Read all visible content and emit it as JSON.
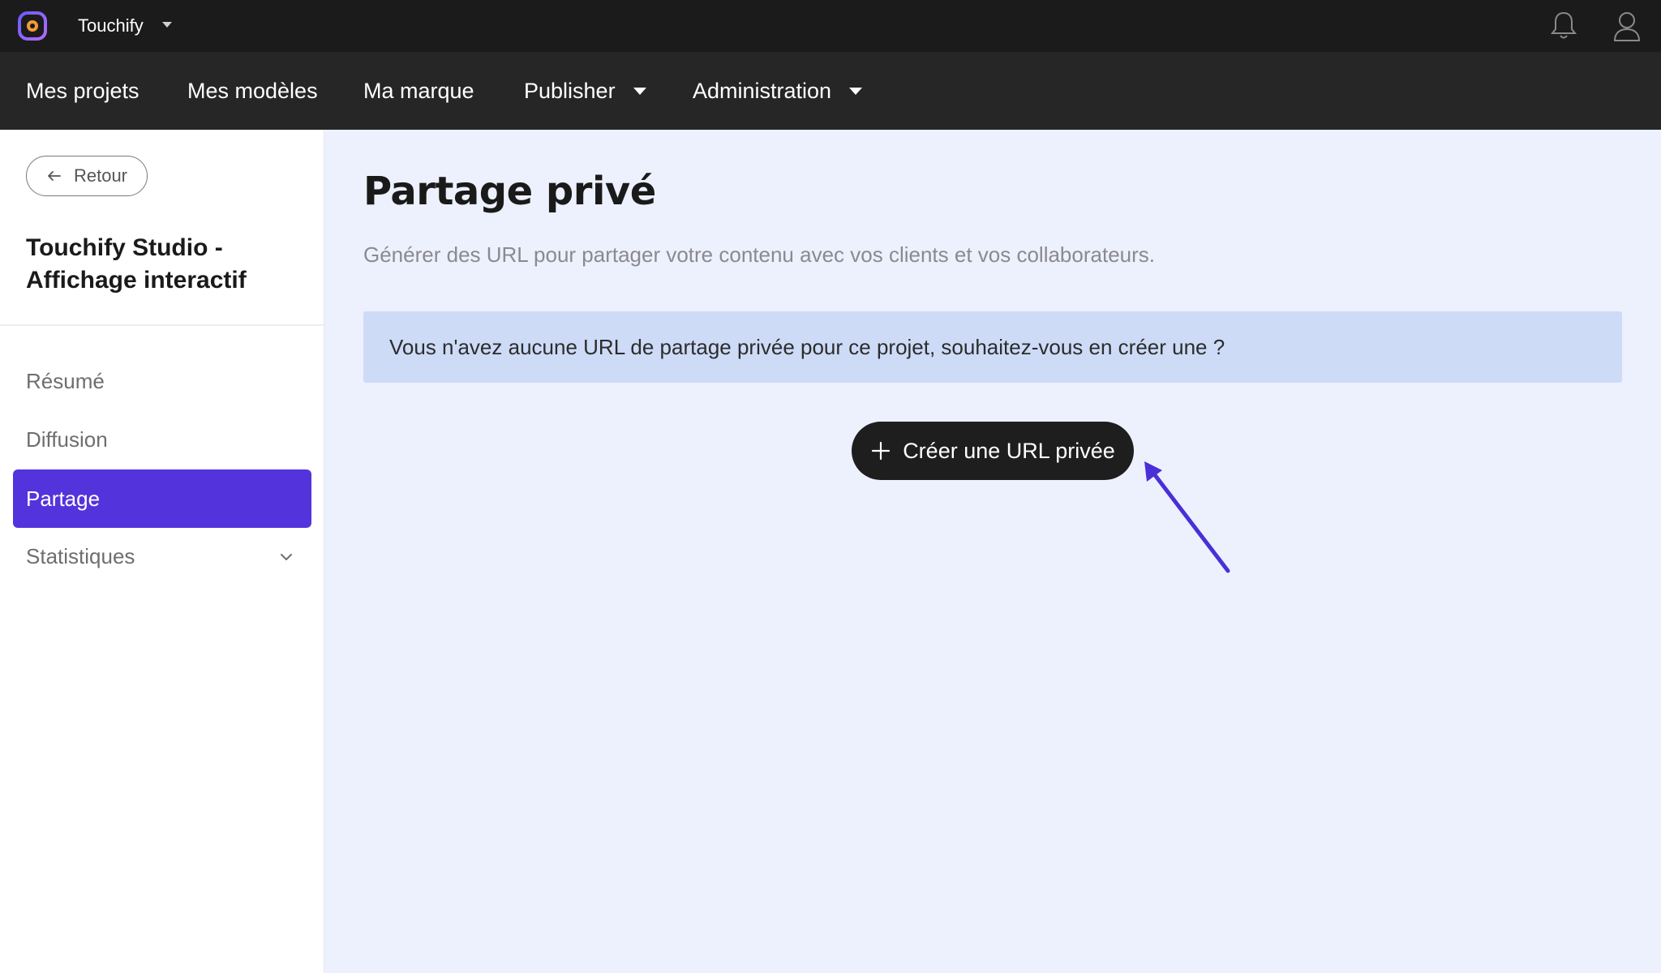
{
  "topbar": {
    "app_name": "Touchify",
    "logo_icon": "touchify-logo-icon",
    "notifications_icon": "bell-icon",
    "account_icon": "user-icon"
  },
  "nav": {
    "items": [
      {
        "label": "Mes projets",
        "has_dropdown": false
      },
      {
        "label": "Mes modèles",
        "has_dropdown": false
      },
      {
        "label": "Ma marque",
        "has_dropdown": false
      },
      {
        "label": "Publisher",
        "has_dropdown": true
      },
      {
        "label": "Administration",
        "has_dropdown": true
      }
    ]
  },
  "sidebar": {
    "back_label": "Retour",
    "project_title": "Touchify Studio - Affichage interactif",
    "items": [
      {
        "label": "Résumé",
        "active": false
      },
      {
        "label": "Diffusion",
        "active": false
      },
      {
        "label": "Partage",
        "active": true
      },
      {
        "label": "Statistiques",
        "active": false,
        "expandable": true
      }
    ]
  },
  "main": {
    "title": "Partage privé",
    "subtitle": "Générer des URL pour partager votre contenu avec vos clients et vos collaborateurs.",
    "info_message": "Vous n'avez aucune URL de partage privée pour ce projet, souhaitez-vous en créer une ?",
    "create_button_label": "Créer une URL privée"
  },
  "colors": {
    "accent": "#5333dc",
    "topbar_bg": "#1b1b1b",
    "navbar_bg": "#262626",
    "page_bg": "#edf1fd",
    "info_bg": "#cddbf7"
  }
}
